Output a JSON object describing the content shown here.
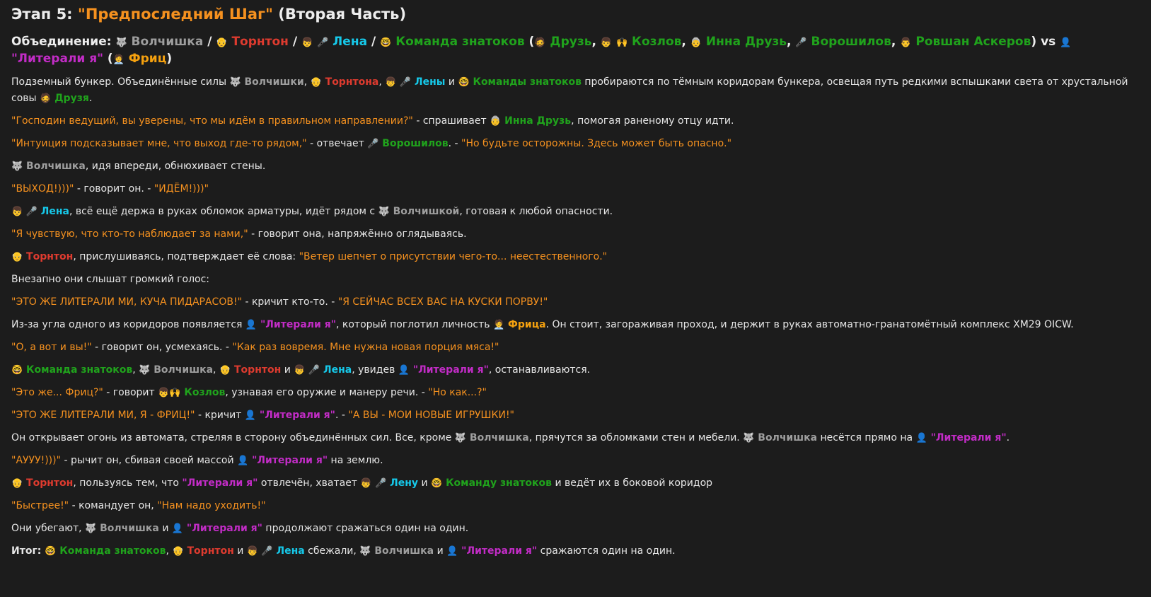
{
  "title_prefix": "Этап 5: ",
  "title_quote": "\"Предпоследний Шаг\"",
  "title_suffix": " (Вторая Часть)",
  "colors": {
    "background": "#1c1c1c",
    "text": "#e6e6e6",
    "quote": "#f5911f",
    "wolf": "#9e9e9e",
    "thornton": "#de3b2f",
    "lena": "#16c9ea",
    "znatoki": "#20a31c",
    "literali": "#c22cc6",
    "fritz": "#f5a10f"
  },
  "icons": {
    "wolf": "🐺",
    "thornton": "👴",
    "lena": "👦",
    "mic": "🎤",
    "nerd": "🤓",
    "druz": "🧔",
    "kozlov": "🙌",
    "inna": "👵",
    "voroshilov": "🎤",
    "ravshan": "👨",
    "literali": "👤",
    "fritz": "🧑‍💼"
  },
  "lines": [
    [
      {
        "t": "Объединение: ",
        "c": "",
        "b": true
      },
      {
        "i": "wolf",
        "n": "wolf-icon"
      },
      {
        "t": " Волчишка",
        "c": "c-gray",
        "b": true
      },
      {
        "t": " / ",
        "c": "",
        "b": true
      },
      {
        "i": "thornton",
        "n": "thornton-icon"
      },
      {
        "t": " Торнтон",
        "c": "c-red",
        "b": true
      },
      {
        "t": " / ",
        "c": "",
        "b": true
      },
      {
        "i": "lena",
        "n": "boy-icon"
      },
      {
        "t": " "
      },
      {
        "i": "mic",
        "n": "microphone-icon"
      },
      {
        "t": " Лена",
        "c": "c-cyan",
        "b": true
      },
      {
        "t": " / ",
        "c": "",
        "b": true
      },
      {
        "i": "nerd",
        "n": "nerd-face-icon"
      },
      {
        "t": " Команда знатоков",
        "c": "c-green",
        "b": true
      },
      {
        "t": " (",
        "c": "",
        "b": true
      },
      {
        "i": "druz",
        "n": "bearded-man-icon"
      },
      {
        "t": " Друзь",
        "c": "c-green",
        "b": true
      },
      {
        "t": ", ",
        "c": "",
        "b": true
      },
      {
        "i": "lena",
        "n": "boy-icon"
      },
      {
        "t": " "
      },
      {
        "i": "kozlov",
        "n": "raised-hands-icon"
      },
      {
        "t": " Козлов",
        "c": "c-green",
        "b": true
      },
      {
        "t": ", ",
        "c": "",
        "b": true
      },
      {
        "i": "inna",
        "n": "old-woman-icon"
      },
      {
        "t": " Инна Друзь",
        "c": "c-green",
        "b": true
      },
      {
        "t": ", ",
        "c": "",
        "b": true
      },
      {
        "i": "voroshilov",
        "n": "microphone-icon"
      },
      {
        "t": " Ворошилов",
        "c": "c-green",
        "b": true
      },
      {
        "t": ", ",
        "c": "",
        "b": true
      },
      {
        "i": "ravshan",
        "n": "man-icon"
      },
      {
        "t": " Ровшан Аскеров",
        "c": "c-green",
        "b": true
      },
      {
        "t": ") vs ",
        "c": "",
        "b": true
      },
      {
        "i": "literali",
        "n": "bust-silhouette-icon"
      },
      {
        "t": " \"Литерали я\"",
        "c": "c-purple",
        "b": true
      },
      {
        "t": " (",
        "c": "",
        "b": true
      },
      {
        "i": "fritz",
        "n": "office-worker-icon"
      },
      {
        "t": " Фриц",
        "c": "c-orange",
        "b": true
      },
      {
        "t": ")",
        "c": "",
        "b": true
      }
    ],
    [
      {
        "t": "Подземный бункер. Объединённые силы "
      },
      {
        "i": "wolf",
        "n": "wolf-icon"
      },
      {
        "t": " Волчишки",
        "c": "c-gray",
        "b": true
      },
      {
        "t": ", "
      },
      {
        "i": "thornton",
        "n": "thornton-icon"
      },
      {
        "t": " Торнтона",
        "c": "c-red",
        "b": true
      },
      {
        "t": ", "
      },
      {
        "i": "lena",
        "n": "boy-icon"
      },
      {
        "t": " "
      },
      {
        "i": "mic",
        "n": "microphone-icon"
      },
      {
        "t": " Лены",
        "c": "c-cyan",
        "b": true
      },
      {
        "t": " и "
      },
      {
        "i": "nerd",
        "n": "nerd-face-icon"
      },
      {
        "t": " Команды знатоков",
        "c": "c-green",
        "b": true
      },
      {
        "t": " пробираются по тёмным коридорам бункера, освещая путь редкими вспышками света от хрустальной совы "
      },
      {
        "i": "druz",
        "n": "bearded-man-icon"
      },
      {
        "t": " Друзя",
        "c": "c-green",
        "b": true
      },
      {
        "t": "."
      }
    ],
    [
      {
        "t": "\"Господин ведущий, вы уверены, что мы идём в правильном направлении?\"",
        "c": "c-q"
      },
      {
        "t": " - спрашивает "
      },
      {
        "i": "inna",
        "n": "old-woman-icon"
      },
      {
        "t": " Инна Друзь",
        "c": "c-green",
        "b": true
      },
      {
        "t": ", помогая раненому отцу идти."
      }
    ],
    [
      {
        "t": "\"Интуиция подсказывает мне, что выход где-то рядом,\"",
        "c": "c-q"
      },
      {
        "t": " - отвечает "
      },
      {
        "i": "voroshilov",
        "n": "microphone-icon"
      },
      {
        "t": " Ворошилов",
        "c": "c-green",
        "b": true
      },
      {
        "t": ". - "
      },
      {
        "t": "\"Но будьте осторожны. Здесь может быть опасно.\"",
        "c": "c-q"
      }
    ],
    [
      {
        "i": "wolf",
        "n": "wolf-icon"
      },
      {
        "t": " Волчишка",
        "c": "c-gray",
        "b": true
      },
      {
        "t": ", идя впереди, обнюхивает стены."
      }
    ],
    [
      {
        "t": "\"ВЫХОД!)))\"",
        "c": "c-q"
      },
      {
        "t": " - говорит он. - "
      },
      {
        "t": "\"ИДЁМ!)))\"",
        "c": "c-q"
      }
    ],
    [
      {
        "i": "lena",
        "n": "boy-icon"
      },
      {
        "t": " "
      },
      {
        "i": "mic",
        "n": "microphone-icon"
      },
      {
        "t": " Лена",
        "c": "c-cyan",
        "b": true
      },
      {
        "t": ", всё ещё держа в руках обломок арматуры, идёт рядом с "
      },
      {
        "i": "wolf",
        "n": "wolf-icon"
      },
      {
        "t": " Волчишкой",
        "c": "c-gray",
        "b": true
      },
      {
        "t": ", готовая к любой опасности."
      }
    ],
    [
      {
        "t": "\"Я чувствую, что кто-то наблюдает за нами,\"",
        "c": "c-q"
      },
      {
        "t": " - говорит она, напряжённо оглядываясь."
      }
    ],
    [
      {
        "i": "thornton",
        "n": "thornton-icon"
      },
      {
        "t": " Торнтон",
        "c": "c-red",
        "b": true
      },
      {
        "t": ", прислушиваясь, подтверждает её слова: "
      },
      {
        "t": "\"Ветер шепчет о присутствии чего-то... неестественного.\"",
        "c": "c-q"
      }
    ],
    [
      {
        "t": "Внезапно они слышат громкий голос:"
      }
    ],
    [
      {
        "t": "\"ЭТО ЖЕ ЛИТЕРАЛИ МИ, КУЧА ПИДАРАСОВ!\"",
        "c": "c-q"
      },
      {
        "t": " - кричит кто-то. - "
      },
      {
        "t": "\"Я СЕЙЧАС ВСЕХ ВАС НА КУСКИ ПОРВУ!\"",
        "c": "c-q"
      }
    ],
    [
      {
        "t": "Из-за угла одного из коридоров появляется "
      },
      {
        "i": "literali",
        "n": "bust-silhouette-icon"
      },
      {
        "t": " \"Литерали я\"",
        "c": "c-purple",
        "b": true
      },
      {
        "t": ", который поглотил личность "
      },
      {
        "i": "fritz",
        "n": "office-worker-icon"
      },
      {
        "t": " Фрица",
        "c": "c-orange",
        "b": true
      },
      {
        "t": ". Он стоит, загораживая проход, и держит в руках автоматно-гранатомётный комплекс XM29 OICW."
      }
    ],
    [
      {
        "t": "\"О, а вот и вы!\"",
        "c": "c-q"
      },
      {
        "t": " - говорит он, усмехаясь. - "
      },
      {
        "t": "\"Как раз вовремя. Мне нужна новая порция мяса!\"",
        "c": "c-q"
      }
    ],
    [
      {
        "i": "nerd",
        "n": "nerd-face-icon"
      },
      {
        "t": " Команда знатоков",
        "c": "c-green",
        "b": true
      },
      {
        "t": ", "
      },
      {
        "i": "wolf",
        "n": "wolf-icon"
      },
      {
        "t": " Волчишка",
        "c": "c-gray",
        "b": true
      },
      {
        "t": ", "
      },
      {
        "i": "thornton",
        "n": "thornton-icon"
      },
      {
        "t": " Торнтон",
        "c": "c-red",
        "b": true
      },
      {
        "t": " и "
      },
      {
        "i": "lena",
        "n": "boy-icon"
      },
      {
        "t": " "
      },
      {
        "i": "mic",
        "n": "microphone-icon"
      },
      {
        "t": " Лена",
        "c": "c-cyan",
        "b": true
      },
      {
        "t": ", увидев "
      },
      {
        "i": "literali",
        "n": "bust-silhouette-icon"
      },
      {
        "t": " \"Литерали я\"",
        "c": "c-purple",
        "b": true
      },
      {
        "t": ", останавливаются."
      }
    ],
    [
      {
        "t": "\"Это же... Фриц?\"",
        "c": "c-q"
      },
      {
        "t": " - говорит "
      },
      {
        "i": "lena",
        "n": "boy-icon"
      },
      {
        "i": "kozlov",
        "n": "raised-hands-icon"
      },
      {
        "t": " Козлов",
        "c": "c-green",
        "b": true
      },
      {
        "t": ", узнавая его оружие и манеру речи. - "
      },
      {
        "t": "\"Но как...?\"",
        "c": "c-q"
      }
    ],
    [
      {
        "t": "\"ЭТО ЖЕ ЛИТЕРАЛИ МИ, Я - ФРИЦ!\"",
        "c": "c-q"
      },
      {
        "t": " - кричит "
      },
      {
        "i": "literali",
        "n": "bust-silhouette-icon"
      },
      {
        "t": " \"Литерали я\"",
        "c": "c-purple",
        "b": true
      },
      {
        "t": ". - "
      },
      {
        "t": "\"А ВЫ - МОИ НОВЫЕ ИГРУШКИ!\"",
        "c": "c-q"
      }
    ],
    [
      {
        "t": "Он открывает огонь из автомата, стреляя в сторону объединённых сил. Все, кроме "
      },
      {
        "i": "wolf",
        "n": "wolf-icon"
      },
      {
        "t": " Волчишка",
        "c": "c-gray",
        "b": true
      },
      {
        "t": ", прячутся за обломками стен и мебели. "
      },
      {
        "i": "wolf",
        "n": "wolf-icon"
      },
      {
        "t": " Волчишка",
        "c": "c-gray",
        "b": true
      },
      {
        "t": " несётся прямо на "
      },
      {
        "i": "literali",
        "n": "bust-silhouette-icon"
      },
      {
        "t": " \"Литерали я\"",
        "c": "c-purple",
        "b": true
      },
      {
        "t": "."
      }
    ],
    [
      {
        "t": "\"АУУУ!)))\"",
        "c": "c-q"
      },
      {
        "t": " - рычит он, сбивая своей массой "
      },
      {
        "i": "literali",
        "n": "bust-silhouette-icon"
      },
      {
        "t": " \"Литерали я\"",
        "c": "c-purple",
        "b": true
      },
      {
        "t": " на землю."
      }
    ],
    [
      {
        "i": "thornton",
        "n": "thornton-icon"
      },
      {
        "t": " Торнтон",
        "c": "c-red",
        "b": true
      },
      {
        "t": ", пользуясь тем, что "
      },
      {
        "t": "\"Литерали я\"",
        "c": "c-purple",
        "b": true
      },
      {
        "t": " отвлечён, хватает "
      },
      {
        "i": "lena",
        "n": "boy-icon"
      },
      {
        "t": " "
      },
      {
        "i": "mic",
        "n": "microphone-icon"
      },
      {
        "t": " Лену",
        "c": "c-cyan",
        "b": true
      },
      {
        "t": " и "
      },
      {
        "i": "nerd",
        "n": "nerd-face-icon"
      },
      {
        "t": " Команду знатоков",
        "c": "c-green",
        "b": true
      },
      {
        "t": " и ведёт их в боковой коридор"
      }
    ],
    [
      {
        "t": "\"Быстрее!\"",
        "c": "c-q"
      },
      {
        "t": " - командует он, "
      },
      {
        "t": "\"Нам надо уходить!\"",
        "c": "c-q"
      }
    ],
    [
      {
        "t": "Они убегают, "
      },
      {
        "i": "wolf",
        "n": "wolf-icon"
      },
      {
        "t": " Волчишка",
        "c": "c-gray",
        "b": true
      },
      {
        "t": " и "
      },
      {
        "i": "literali",
        "n": "bust-silhouette-icon"
      },
      {
        "t": " \"Литерали я\"",
        "c": "c-purple",
        "b": true
      },
      {
        "t": " продолжают сражаться один на один."
      }
    ],
    [
      {
        "t": "Итог: ",
        "b": true
      },
      {
        "i": "nerd",
        "n": "nerd-face-icon"
      },
      {
        "t": " Команда знатоков",
        "c": "c-green",
        "b": true
      },
      {
        "t": ", "
      },
      {
        "i": "thornton",
        "n": "thornton-icon"
      },
      {
        "t": " Торнтон",
        "c": "c-red",
        "b": true
      },
      {
        "t": " и "
      },
      {
        "i": "lena",
        "n": "boy-icon"
      },
      {
        "t": " "
      },
      {
        "i": "mic",
        "n": "microphone-icon"
      },
      {
        "t": " Лена",
        "c": "c-cyan",
        "b": true
      },
      {
        "t": " сбежали, "
      },
      {
        "i": "wolf",
        "n": "wolf-icon"
      },
      {
        "t": " Волчишка",
        "c": "c-gray",
        "b": true
      },
      {
        "t": " и "
      },
      {
        "i": "literali",
        "n": "bust-silhouette-icon"
      },
      {
        "t": " \"Литерали я\"",
        "c": "c-purple",
        "b": true
      },
      {
        "t": " сражаются один на один."
      }
    ]
  ]
}
